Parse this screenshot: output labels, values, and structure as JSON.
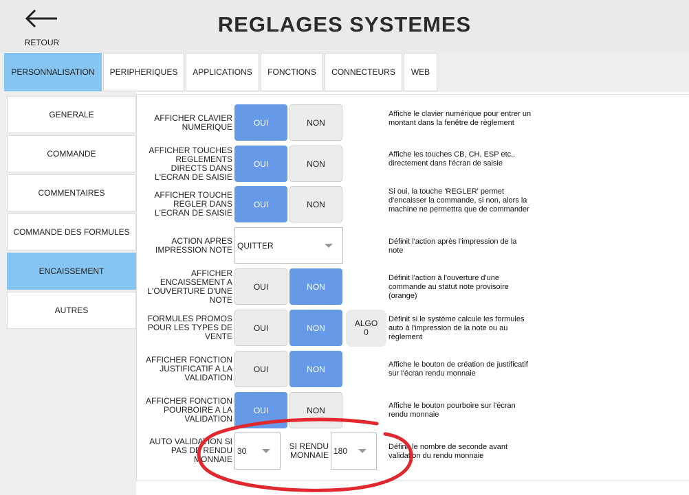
{
  "header": {
    "back_label": "RETOUR",
    "title": "REGLAGES SYSTEMES"
  },
  "tabs": [
    {
      "label": "PERSONNALISATION",
      "active": true
    },
    {
      "label": "PERIPHERIQUES",
      "active": false
    },
    {
      "label": "APPLICATIONS",
      "active": false
    },
    {
      "label": "FONCTIONS",
      "active": false
    },
    {
      "label": "CONNECTEURS",
      "active": false
    },
    {
      "label": "WEB",
      "active": false
    }
  ],
  "sidebar": [
    {
      "label": "GENERALE",
      "active": false
    },
    {
      "label": "COMMANDE",
      "active": false
    },
    {
      "label": "COMMENTAIRES",
      "active": false
    },
    {
      "label": "COMMANDE DES FORMULES",
      "active": false
    },
    {
      "label": "ENCAISSEMENT",
      "active": true
    },
    {
      "label": "AUTRES",
      "active": false
    }
  ],
  "settings": [
    {
      "label": "AFFICHER CLAVIER NUMERIQUE",
      "oui": "OUI",
      "non": "NON",
      "value": "OUI",
      "desc": "Affiche le clavier numérique pour entrer un montant dans la fenêtre de règlement"
    },
    {
      "label": "AFFICHER TOUCHES REGLEMENTS DIRECTS DANS L'ECRAN DE SAISIE",
      "oui": "OUI",
      "non": "NON",
      "value": "OUI",
      "desc": "Affiche les touches CB, CH, ESP etc.. directement dans l'écran de saisie"
    },
    {
      "label": "AFFICHER TOUCHE REGLER DANS L'ECRAN DE SAISIE",
      "oui": "OUI",
      "non": "NON",
      "value": "OUI",
      "desc": "Si oui, la touche 'REGLER' permet d'encaisser la commande, si non, alors la machine ne permettra que de commander"
    },
    {
      "label": "ACTION APRES IMPRESSION NOTE",
      "select_value": "QUITTER",
      "desc": "Définit l'action après l'impression de la note"
    },
    {
      "label": "AFFICHER ENCAISSEMENT A L'OUVERTURE D'UNE NOTE",
      "oui": "OUI",
      "non": "NON",
      "value": "NON",
      "desc": "Définit l'action à l'ouverture d'une commande au statut note provisoire (orange)"
    },
    {
      "label": "FORMULES PROMOS POUR LES TYPES DE VENTE",
      "oui": "OUI",
      "non": "NON",
      "value": "NON",
      "algo_label": "ALGO",
      "algo_value": "0",
      "desc": "Définit si le système calcule les formules auto à l'impression de la note ou au règlement"
    },
    {
      "label": "AFFICHER FONCTION JUSTIFICATIF A LA VALIDATION",
      "oui": "OUI",
      "non": "NON",
      "value": "NON",
      "desc": "Affiche le bouton de création de justificatif sur l'écran rendu monnaie"
    },
    {
      "label": "AFFICHER FONCTION POURBOIRE A LA VALIDATION",
      "oui": "OUI",
      "non": "NON",
      "value": "OUI",
      "desc": "Affiche le bouton pourboire sur l'écran rendu monnaie"
    },
    {
      "label": "AUTO VALIDATION SI PAS DE RENDU MONNAIE",
      "select_value": "30",
      "label2": "SI RENDU MONNAIE",
      "select2_value": "180",
      "desc": "Définit le nombre de seconde avant validation du rendu monnaie"
    }
  ],
  "colors": {
    "accent_light": "#86c5f2",
    "toggle_on": "#6699e8",
    "annotation": "#e0282e"
  }
}
